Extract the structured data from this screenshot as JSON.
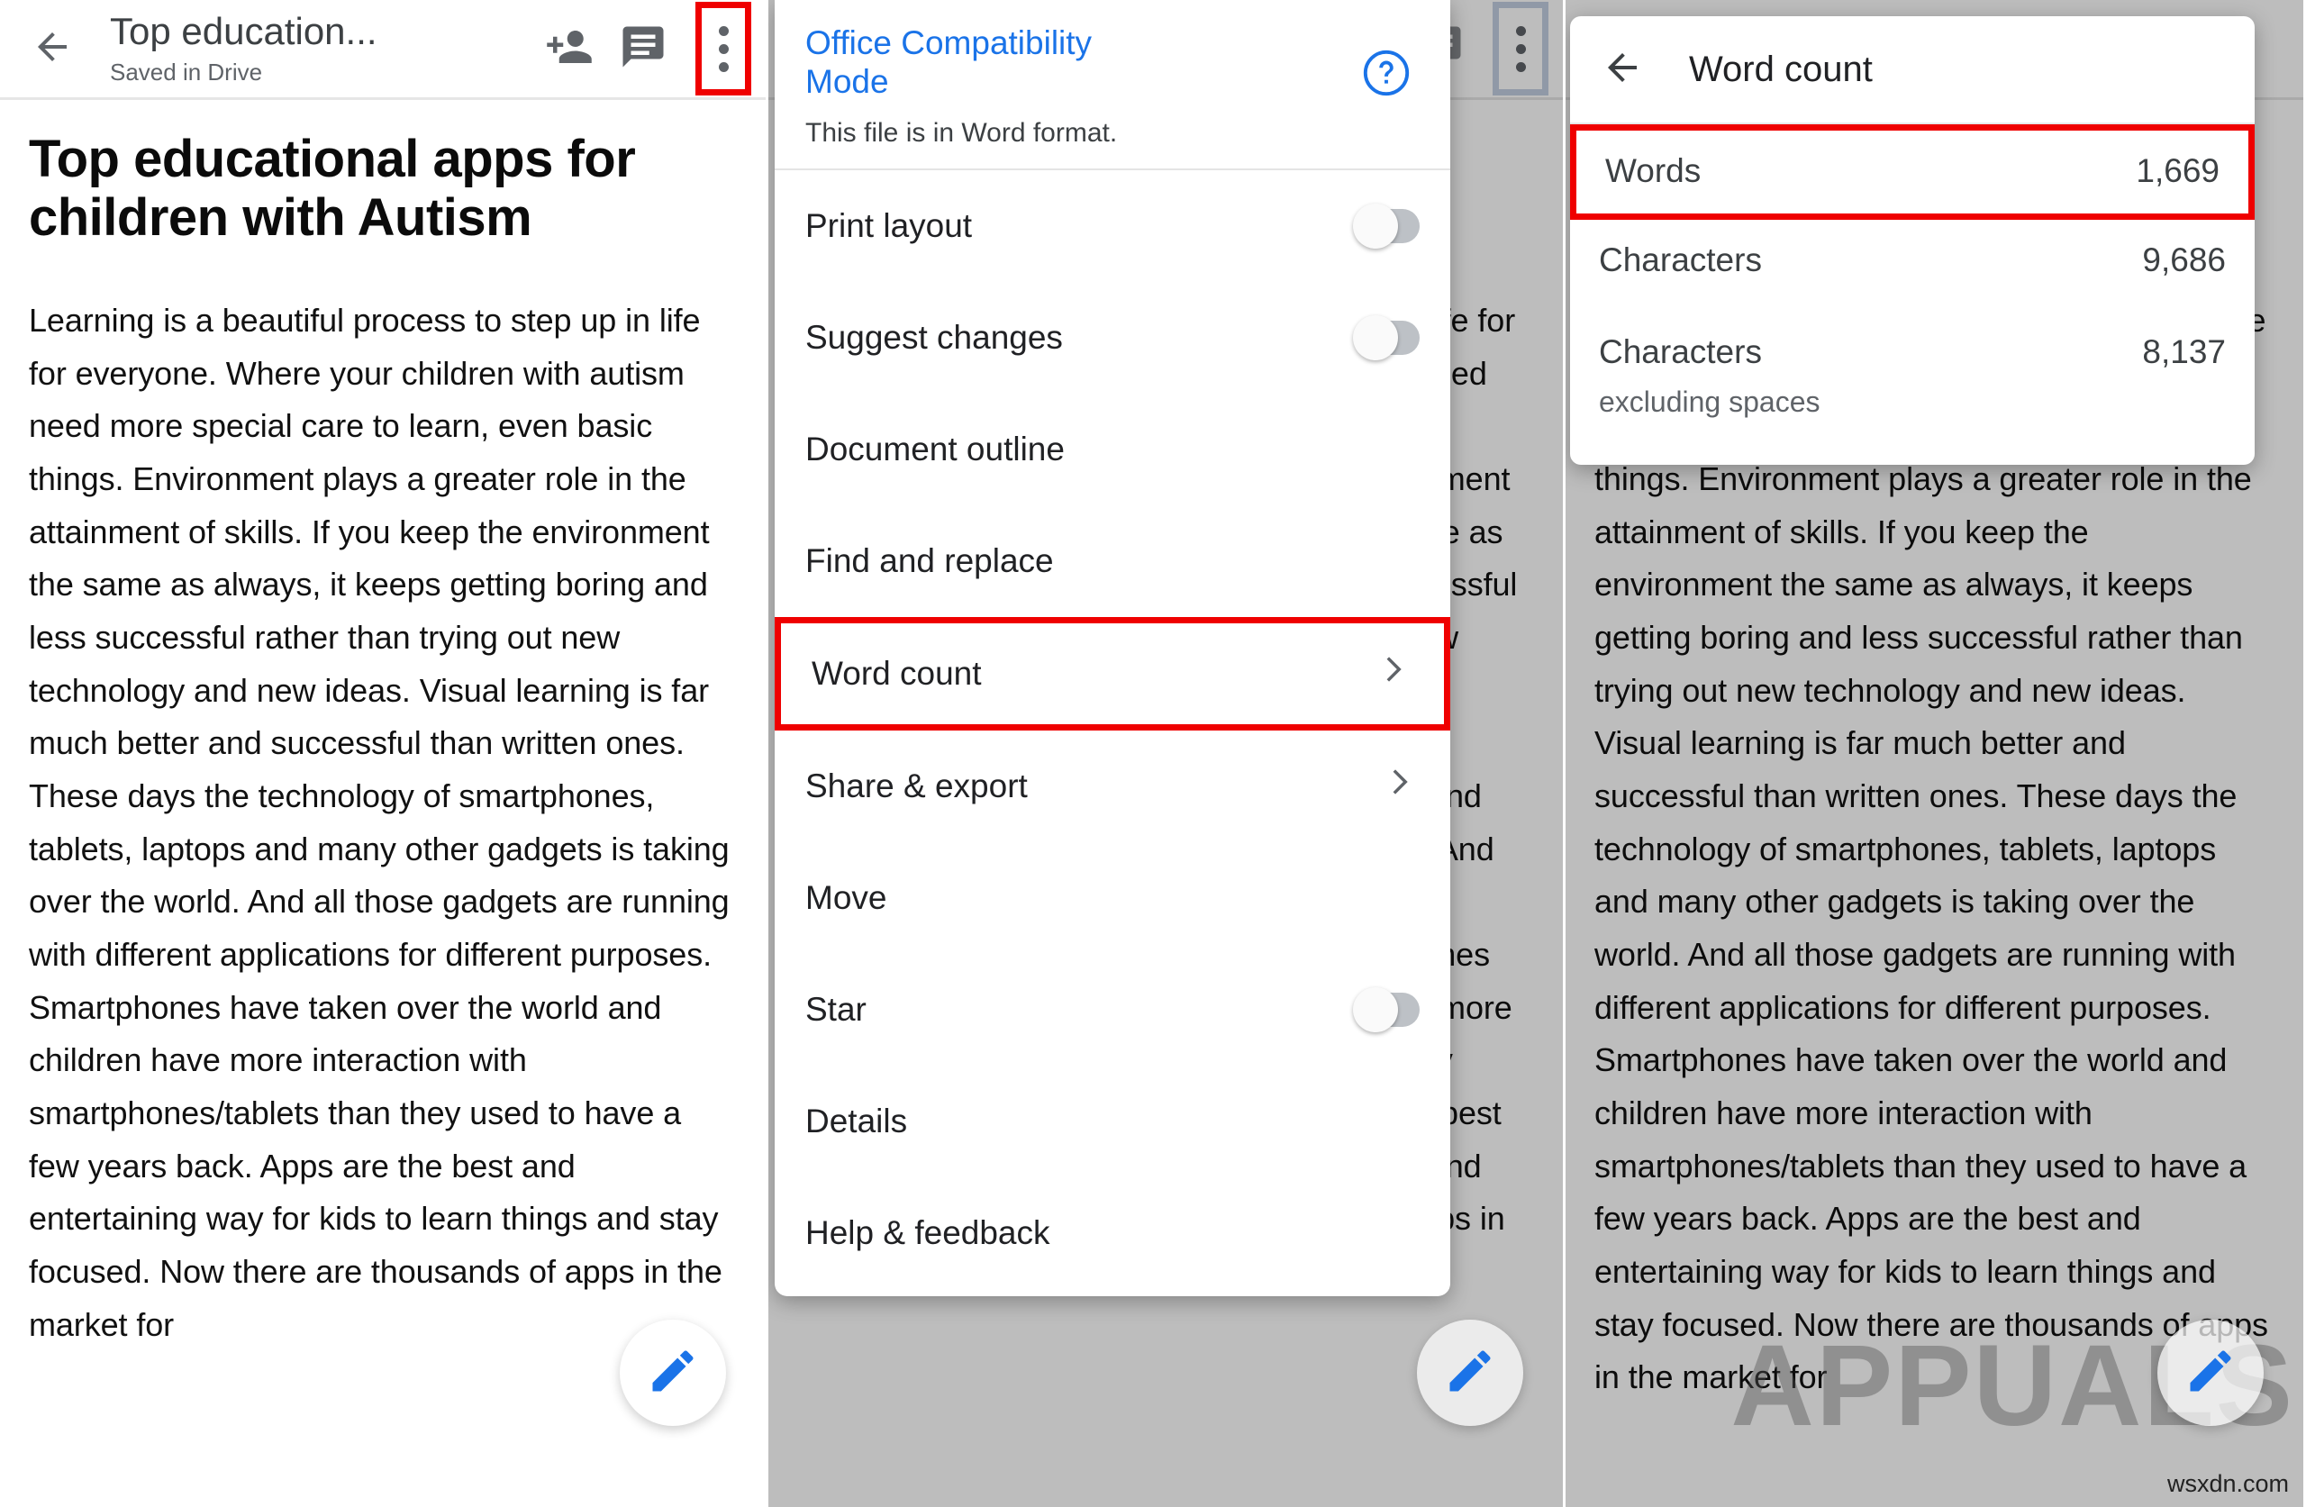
{
  "app": {
    "doc_title": "Top education...",
    "doc_subtitle": "Saved in Drive"
  },
  "document": {
    "heading": "Top educational apps for children with Autism",
    "body": "Learning is a beautiful process to step up in life for everyone. Where your children with autism need more special care to learn, even basic things. Environment plays a greater role in the attainment of skills. If you keep the environment the same as always, it keeps getting boring and less successful rather than trying out new technology and new ideas. Visual learning is far much better and successful than written ones. These days the technology of smartphones, tablets, laptops and many other gadgets is taking over the world. And all those gadgets are running with different applications for different purposes. Smartphones have taken over the world and children have more interaction with smartphones/tablets than they used to have a few years back. Apps are the best and entertaining way for kids to learn things and stay focused. Now there are thousands of apps in the market for"
  },
  "overflow_menu": {
    "office_mode_title": "Office Compatibility Mode",
    "office_mode_subtitle": "This file is in Word format.",
    "help_icon": "help-circle-icon",
    "items": [
      {
        "label": "Print layout",
        "control": "toggle",
        "state": "off",
        "highlighted": false
      },
      {
        "label": "Suggest changes",
        "control": "toggle",
        "state": "off",
        "highlighted": false
      },
      {
        "label": "Document outline",
        "control": "none",
        "state": "",
        "highlighted": false
      },
      {
        "label": "Find and replace",
        "control": "none",
        "state": "",
        "highlighted": false
      },
      {
        "label": "Word count",
        "control": "chevron",
        "state": "",
        "highlighted": true
      },
      {
        "label": "Share & export",
        "control": "chevron",
        "state": "",
        "highlighted": false
      },
      {
        "label": "Move",
        "control": "none",
        "state": "",
        "highlighted": false
      },
      {
        "label": "Star",
        "control": "toggle",
        "state": "off",
        "highlighted": false
      },
      {
        "label": "Details",
        "control": "none",
        "state": "",
        "highlighted": false
      },
      {
        "label": "Help & feedback",
        "control": "none",
        "state": "",
        "highlighted": false
      }
    ]
  },
  "word_count_dialog": {
    "title": "Word count",
    "back_icon": "arrow-left-icon",
    "rows": [
      {
        "label": "Words",
        "sub": "",
        "value": "1,669",
        "highlighted": true
      },
      {
        "label": "Characters",
        "sub": "",
        "value": "9,686",
        "highlighted": false
      },
      {
        "label": "Characters",
        "sub": "excluding spaces",
        "value": "8,137",
        "highlighted": false
      }
    ]
  },
  "toolbar": {
    "back_icon": "arrow-left-icon",
    "add_person_icon": "person-add-icon",
    "comment_icon": "comment-icon",
    "more_icon": "kebab-menu-icon",
    "edit_fab_icon": "pencil-icon"
  },
  "watermark": {
    "brand": "APPUALS",
    "site": "wsxdn.com"
  },
  "colors": {
    "accent_blue": "#1a73e8",
    "highlight_red": "#ef0000",
    "text_primary": "#202124",
    "text_secondary": "#5f6368",
    "scrim": "rgba(0,0,0,0.26)"
  }
}
